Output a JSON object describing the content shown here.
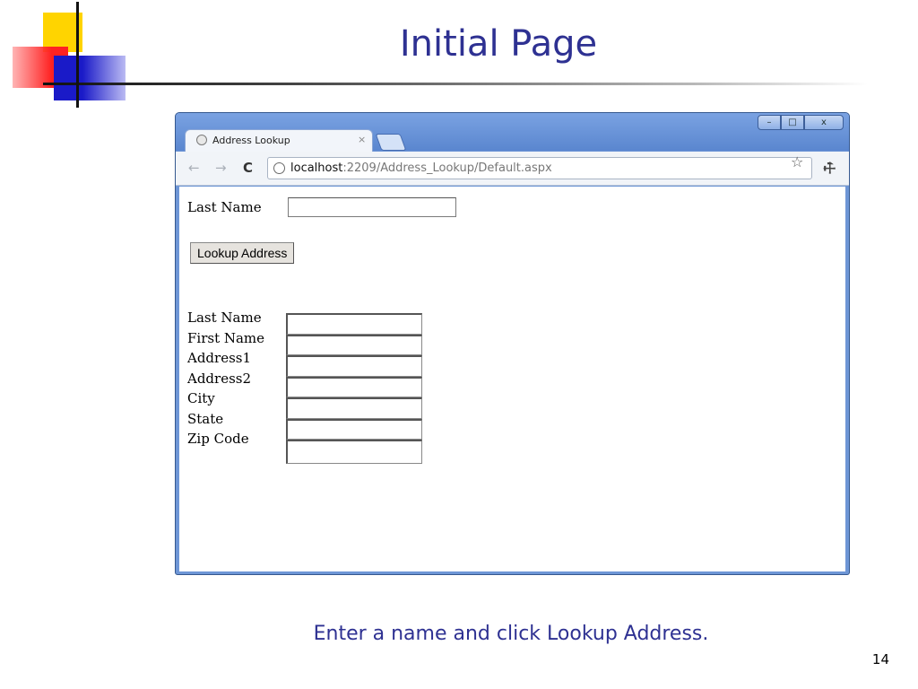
{
  "slide": {
    "title": "Initial Page",
    "caption": "Enter a name and click Lookup Address.",
    "page_number": "14"
  },
  "browser": {
    "tab_title": "Address Lookup",
    "tab_close": "×",
    "window_buttons": {
      "minimize": "–",
      "maximize": "□",
      "close": "x"
    },
    "nav": {
      "back": "←",
      "forward": "→",
      "reload": "C"
    },
    "url_host": "localhost",
    "url_rest": ":2209/Address_Lookup/Default.aspx",
    "star": "☆",
    "wrench": "🔧"
  },
  "form": {
    "search_label": "Last Name",
    "search_value": "",
    "button_label": "Lookup Address",
    "result_labels": [
      "Last Name",
      "First Name",
      "Address1",
      "Address2",
      "City",
      "State",
      "Zip Code"
    ],
    "result_values": [
      "",
      "",
      "",
      "",
      "",
      "",
      ""
    ]
  },
  "colors": {
    "title_blue": "#2e3192",
    "window_frame": "#6e96d6",
    "deco_yellow": "#ffd400",
    "deco_red": "#f22222",
    "deco_blue": "#1a1ac8"
  }
}
